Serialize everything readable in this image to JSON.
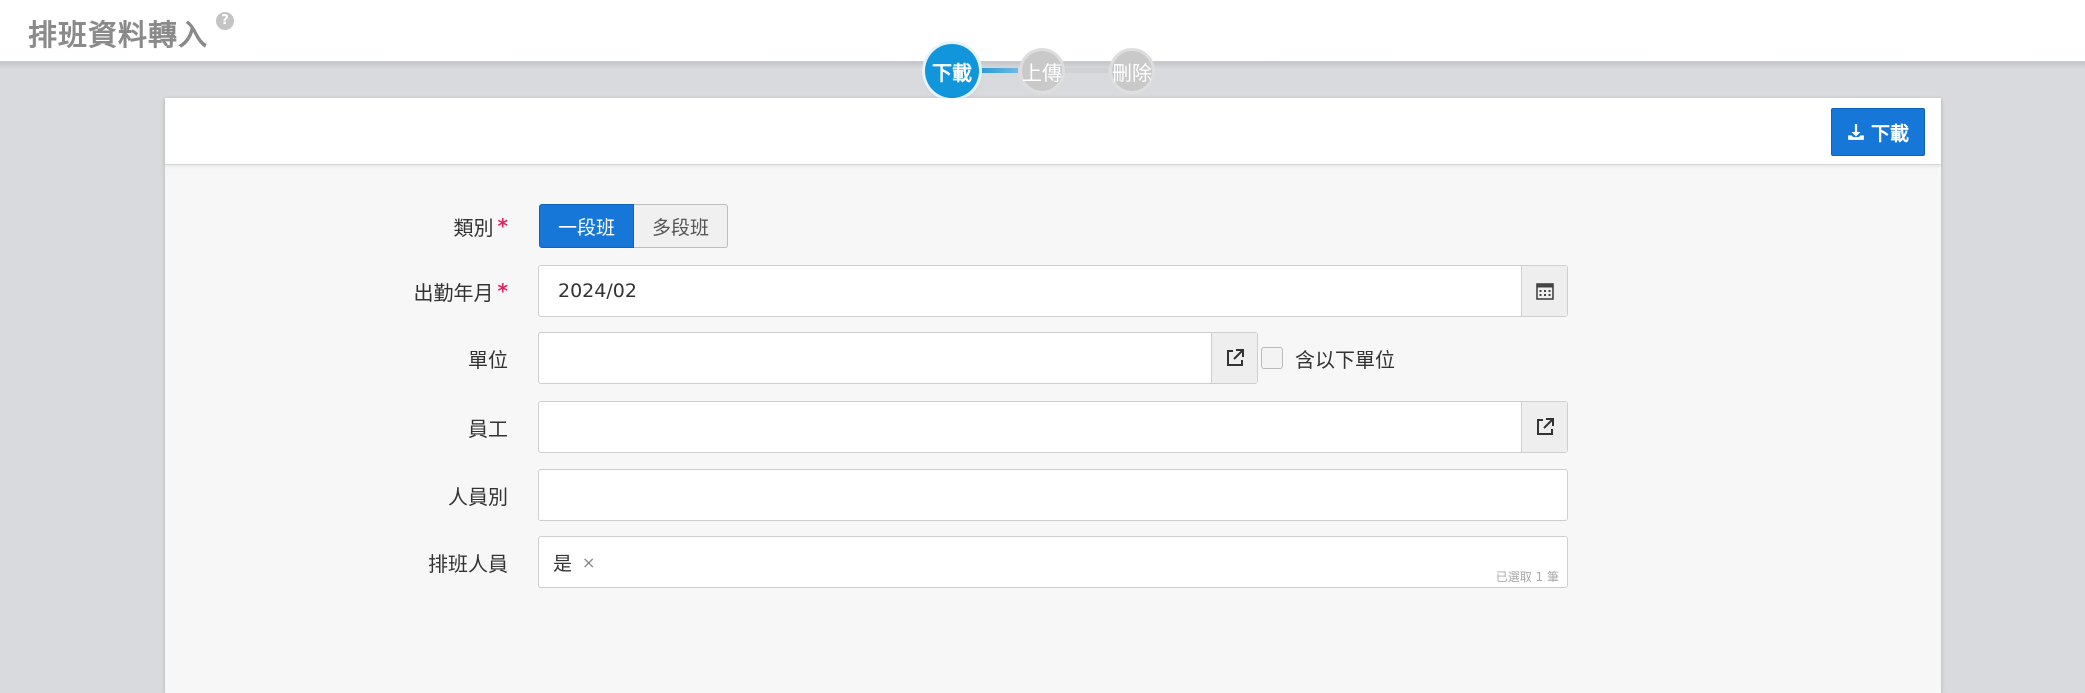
{
  "header": {
    "title": "排班資料轉入",
    "help_glyph": "?"
  },
  "steps": [
    {
      "label": "下載",
      "state": "active"
    },
    {
      "label": "上傳",
      "state": "inactive"
    },
    {
      "label": "刪除",
      "state": "inactive"
    }
  ],
  "toolbar": {
    "download_label": "下載"
  },
  "form": {
    "category": {
      "label": "類別",
      "required_mark": "*",
      "options": [
        "一段班",
        "多段班"
      ],
      "selected": "一段班"
    },
    "attendance_month": {
      "label": "出勤年月",
      "required_mark": "*",
      "value": "2024/02"
    },
    "unit": {
      "label": "單位",
      "value": "",
      "include_sub_label": "含以下單位",
      "include_sub_checked": false
    },
    "employee": {
      "label": "員工",
      "value": ""
    },
    "staff_type": {
      "label": "人員別",
      "value": ""
    },
    "scheduling_staff": {
      "label": "排班人員",
      "tag": "是",
      "tag_remove": "×",
      "count_note": "已選取 1 筆"
    }
  },
  "colors": {
    "accent": "#1677d9",
    "step_active": "#1196dc",
    "required": "#e0245e"
  }
}
